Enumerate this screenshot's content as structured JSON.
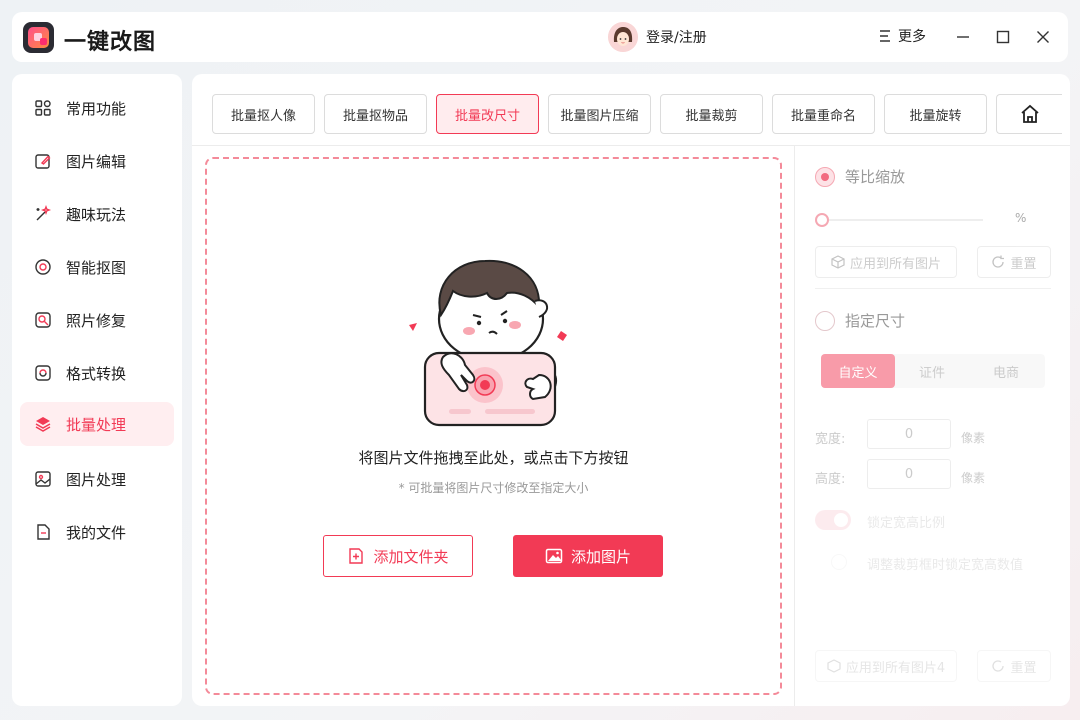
{
  "app": {
    "title": "一键改图"
  },
  "header": {
    "login_label": "登录/注册",
    "more_label": "更多"
  },
  "sidebar": {
    "items": [
      {
        "label": "常用功能",
        "icon": "grid-icon"
      },
      {
        "label": "图片编辑",
        "icon": "edit-icon"
      },
      {
        "label": "趣味玩法",
        "icon": "magic-wand-icon"
      },
      {
        "label": "智能抠图",
        "icon": "target-icon"
      },
      {
        "label": "照片修复",
        "icon": "photo-repair-icon"
      },
      {
        "label": "格式转换",
        "icon": "convert-icon"
      },
      {
        "label": "批量处理",
        "icon": "layers-icon",
        "active": true
      },
      {
        "label": "图片处理",
        "icon": "image-icon"
      },
      {
        "label": "我的文件",
        "icon": "file-icon"
      }
    ]
  },
  "tabs": [
    {
      "label": "批量抠人像"
    },
    {
      "label": "批量抠物品"
    },
    {
      "label": "批量改尺寸",
      "active": true
    },
    {
      "label": "批量图片压缩"
    },
    {
      "label": "批量裁剪"
    },
    {
      "label": "批量重命名"
    },
    {
      "label": "批量旋转"
    }
  ],
  "dropzone": {
    "main_text": "将图片文件拖拽至此处，或点击下方按钮",
    "sub_text": "* 可批量将图片尺寸修改至指定大小",
    "add_folder_label": "添加文件夹",
    "add_image_label": "添加图片"
  },
  "panel": {
    "proportional_label": "等比缩放",
    "percent_unit": "%",
    "scale_value": 0,
    "apply_all_label": "应用到所有图片",
    "reset_label": "重置",
    "fixed_size_label": "指定尺寸",
    "segments": [
      "自定义",
      "证件",
      "电商"
    ],
    "width_label": "宽度:",
    "height_label": "高度:",
    "width_value": "0",
    "height_value": "0",
    "unit_label": "像素",
    "lock_ratio_label": "锁定宽高比例",
    "crop_lock_label": "调整裁剪框时锁定宽高数值",
    "bottom_apply_label": "应用到所有图片4",
    "bottom_reset_label": "重置"
  },
  "colors": {
    "accent": "#f23a55",
    "accent_light": "#ffecee",
    "dash_border": "#f48a99"
  }
}
